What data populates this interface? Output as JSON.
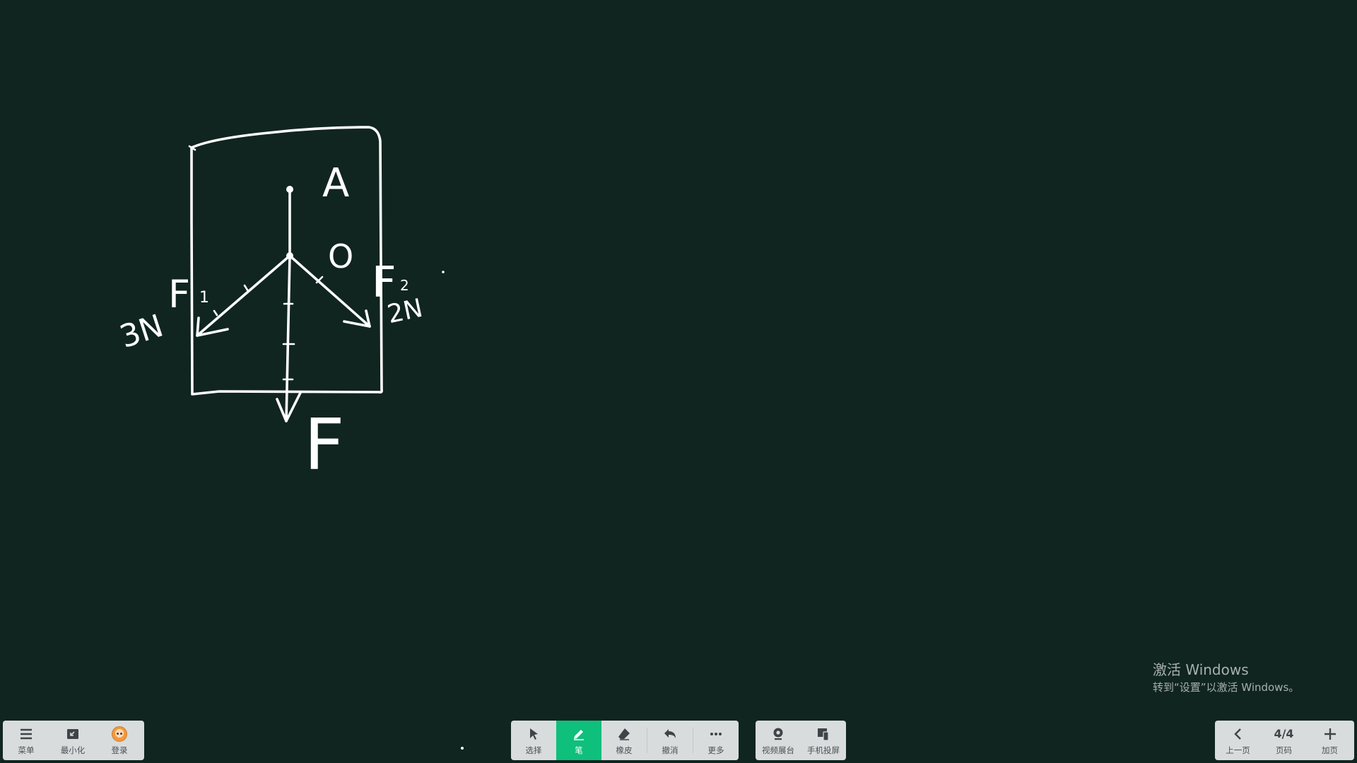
{
  "board": {
    "background": "#10251f",
    "ink_color": "#ffffff",
    "labels": {
      "point_a": "A",
      "point_o": "O",
      "force_f": "F",
      "force_f1": "F",
      "force_f1_sub": "1",
      "force_f1_mag": "3N",
      "force_f2": "F",
      "force_f2_sub": "2",
      "force_f2_mag": "2N"
    }
  },
  "left_toolbar": {
    "menu": {
      "label": "菜单",
      "icon": "hamburger-icon"
    },
    "minimize": {
      "label": "最小化",
      "icon": "minimize-icon"
    },
    "login": {
      "label": "登录",
      "icon": "avatar-icon"
    }
  },
  "center_toolbar": {
    "select": {
      "label": "选择",
      "icon": "cursor-icon"
    },
    "pen": {
      "label": "笔",
      "icon": "pen-icon",
      "active": true
    },
    "eraser": {
      "label": "橡皮",
      "icon": "eraser-icon"
    },
    "undo": {
      "label": "撤消",
      "icon": "undo-icon"
    },
    "more": {
      "label": "更多",
      "icon": "more-icon"
    }
  },
  "screen_toolbar": {
    "video_booth": {
      "label": "视频展台",
      "icon": "camera-icon"
    },
    "phone_cast": {
      "label": "手机投屏",
      "icon": "phone-cast-icon"
    }
  },
  "right_toolbar": {
    "prev": {
      "label": "上一页",
      "icon": "chevron-left-icon"
    },
    "page": {
      "value": "4/4",
      "label": "页码"
    },
    "add": {
      "label": "加页",
      "icon": "plus-icon"
    }
  },
  "watermark": {
    "title": "激活 Windows",
    "subtitle": "转到“设置”以激活 Windows。"
  },
  "colors": {
    "accent": "#0fbf7c",
    "toolbar_bg": "#d8dcdd"
  }
}
